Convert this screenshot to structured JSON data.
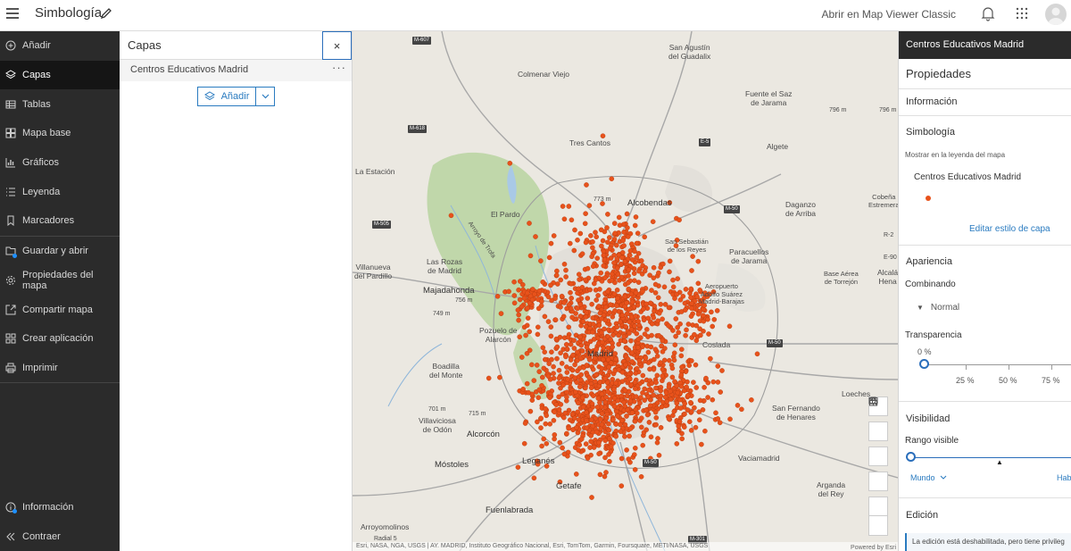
{
  "header": {
    "title": "Simbología",
    "classic_link": "Abrir en Map Viewer Classic"
  },
  "leftnav": {
    "items": [
      {
        "label": "Añadir",
        "icon": "plus-circle-icon"
      },
      {
        "label": "Capas",
        "icon": "layers-icon"
      },
      {
        "label": "Tablas",
        "icon": "table-icon"
      },
      {
        "label": "Mapa base",
        "icon": "basemap-icon"
      },
      {
        "label": "Gráficos",
        "icon": "chart-icon"
      },
      {
        "label": "Leyenda",
        "icon": "legend-icon"
      },
      {
        "label": "Marcadores",
        "icon": "bookmark-icon"
      },
      {
        "label": "Guardar y abrir",
        "icon": "save-icon"
      },
      {
        "label": "Propiedades del mapa",
        "icon": "gear-icon"
      },
      {
        "label": "Compartir mapa",
        "icon": "share-icon"
      },
      {
        "label": "Crear aplicación",
        "icon": "apps-icon"
      },
      {
        "label": "Imprimir",
        "icon": "print-icon"
      }
    ],
    "bottom": [
      {
        "label": "Información",
        "icon": "info-icon"
      },
      {
        "label": "Contraer",
        "icon": "collapse-icon"
      }
    ]
  },
  "layers_panel": {
    "title": "Capas",
    "close": "×",
    "layer_name": "Centros Educativos Madrid",
    "more": "···",
    "add_label": "Añadir"
  },
  "map": {
    "labels": {
      "m607": "M-607",
      "sanagustin": "San Agustín\ndel Guadalix",
      "colmenar": "Colmenar Viejo",
      "fuentesaz": "Fuente el Saz\nde Jarama",
      "m796": "796 m",
      "m618": "M-618",
      "trescantos": "Tres Cantos",
      "e5": "E-5",
      "algete": "Algete",
      "laestacion": "La Estación",
      "m773": "773 m",
      "alcobendas": "Alcobendas",
      "m50a": "M-50",
      "elpardo": "El Pardo",
      "m505": "M-505",
      "ribatejada": "Ribatejada",
      "paracuellos": "Paracuellos\nde Jarama",
      "lasrozas": "Las Rozas\nde Madrid",
      "villanueva": "Villanueva\ndel Pardillo",
      "majadahonda": "Majadahonda",
      "m756": "756 m",
      "m749": "749 m",
      "aeropuerto": "Aeropuerto\nAdolfo Suárez\nMadrid-Barajas",
      "basetorrejon": "Base Aérea\nde Torrejón",
      "alcala": "Alcalá\nHena",
      "pozuelo": "Pozuelo de\nAlarcón",
      "madrid": "Madrid",
      "coslada": "Coslada",
      "m50b": "M-50",
      "boadilla": "Boadilla\ndel Monte",
      "m715": "715 m",
      "m701": "701 m",
      "villaviciosa": "Villaviciosa\nde Odón",
      "loeches": "Loeches",
      "alcorcon": "Alcorcón",
      "mostoles": "Móstoles",
      "leganes": "Leganés",
      "m50c": "M-50",
      "vaciamadrid": "Vaciamadrid",
      "sanfernando": "San Fernando\nde Henares",
      "getafe": "Getafe",
      "fuenlabrada": "Fuenlabrada",
      "arroyomolinos": "Arroyomolinos",
      "arganda": "Arganda\ndel Rey",
      "m301": "M-301",
      "radial5": "Radial 5",
      "sansebastian": "San Sebastián\nde los Reyes",
      "daganzo": "Daganzo\nde Arriba",
      "cobena": "Cobeña\nEstremera",
      "r2": "R-2",
      "e90": "E-90",
      "arroyomira": "Arroyo de Trofa",
      "m796b": "796 m"
    },
    "attribution": "Esri, NASA, NGA, USGS | AY. MADRID, Instituto Geográfico Nacional, Esri, TomTom, Garmin, Foursquare, METI/NASA, USGS",
    "powered": "Powered by Esri",
    "point_color": "#e8521b"
  },
  "rpanel": {
    "layer_title": "Centros Educativos Madrid",
    "properties": "Propiedades",
    "information": "Información",
    "symbology": "Simbología",
    "show_legend": "Mostrar en la leyenda del mapa",
    "legend_layer": "Centros Educativos Madrid",
    "edit_style": "Editar estilo de capa",
    "appearance": "Apariencia",
    "blending": "Combinando",
    "blend_mode": "Normal",
    "transparency": "Transparencia",
    "transparency_value": "0 %",
    "t25": "25 %",
    "t50": "50 %",
    "t75": "75 %",
    "visibility": "Visibilidad",
    "visible_range": "Rango visible",
    "range_min": "Mundo",
    "range_max": "Hab",
    "editing": "Edición",
    "editing_note": "La edición está deshabilitada, pero tiene privileg"
  }
}
